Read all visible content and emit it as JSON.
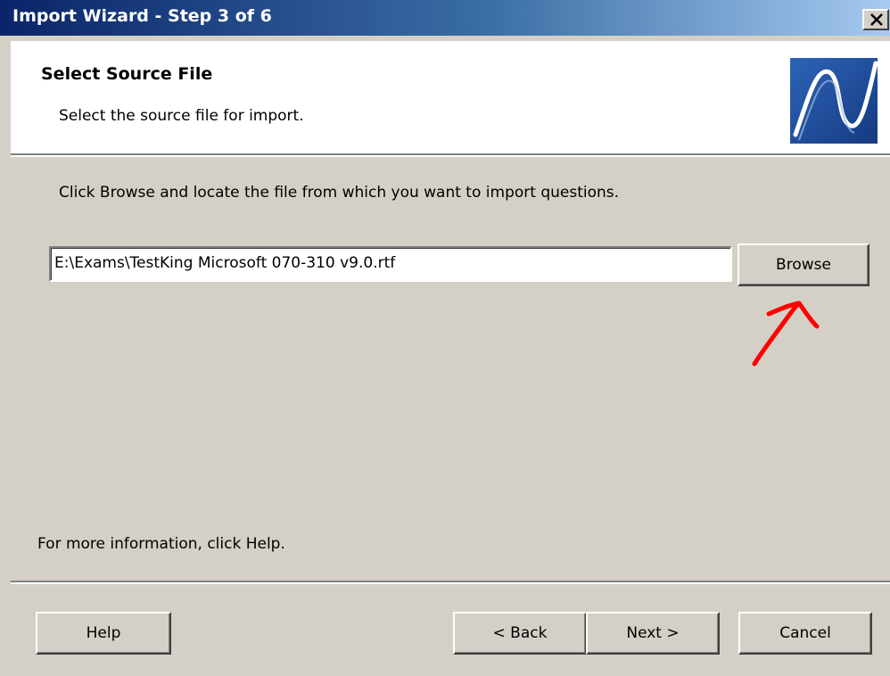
{
  "window": {
    "title": "Import Wizard - Step 3 of 6"
  },
  "header": {
    "title": "Select Source File",
    "subtitle": "Select the source file for import.",
    "logo_icon": "wave-logo-icon"
  },
  "main": {
    "instruction": "Click Browse and locate the file from which you want to import questions.",
    "file_path": "E:\\Exams\\TestKing Microsoft 070-310 v9.0.rtf",
    "browse_label": "Browse",
    "help_text": "For more information, click Help."
  },
  "footer": {
    "help_label": "Help",
    "back_label": "< Back",
    "next_label": "Next >",
    "cancel_label": "Cancel"
  },
  "colors": {
    "titlebar_start": "#0a246a",
    "titlebar_end": "#a6caf0",
    "dialog_face": "#d4d0c8",
    "annotation_arrow": "#ff0000",
    "logo_blue": "#1f4f9e"
  }
}
